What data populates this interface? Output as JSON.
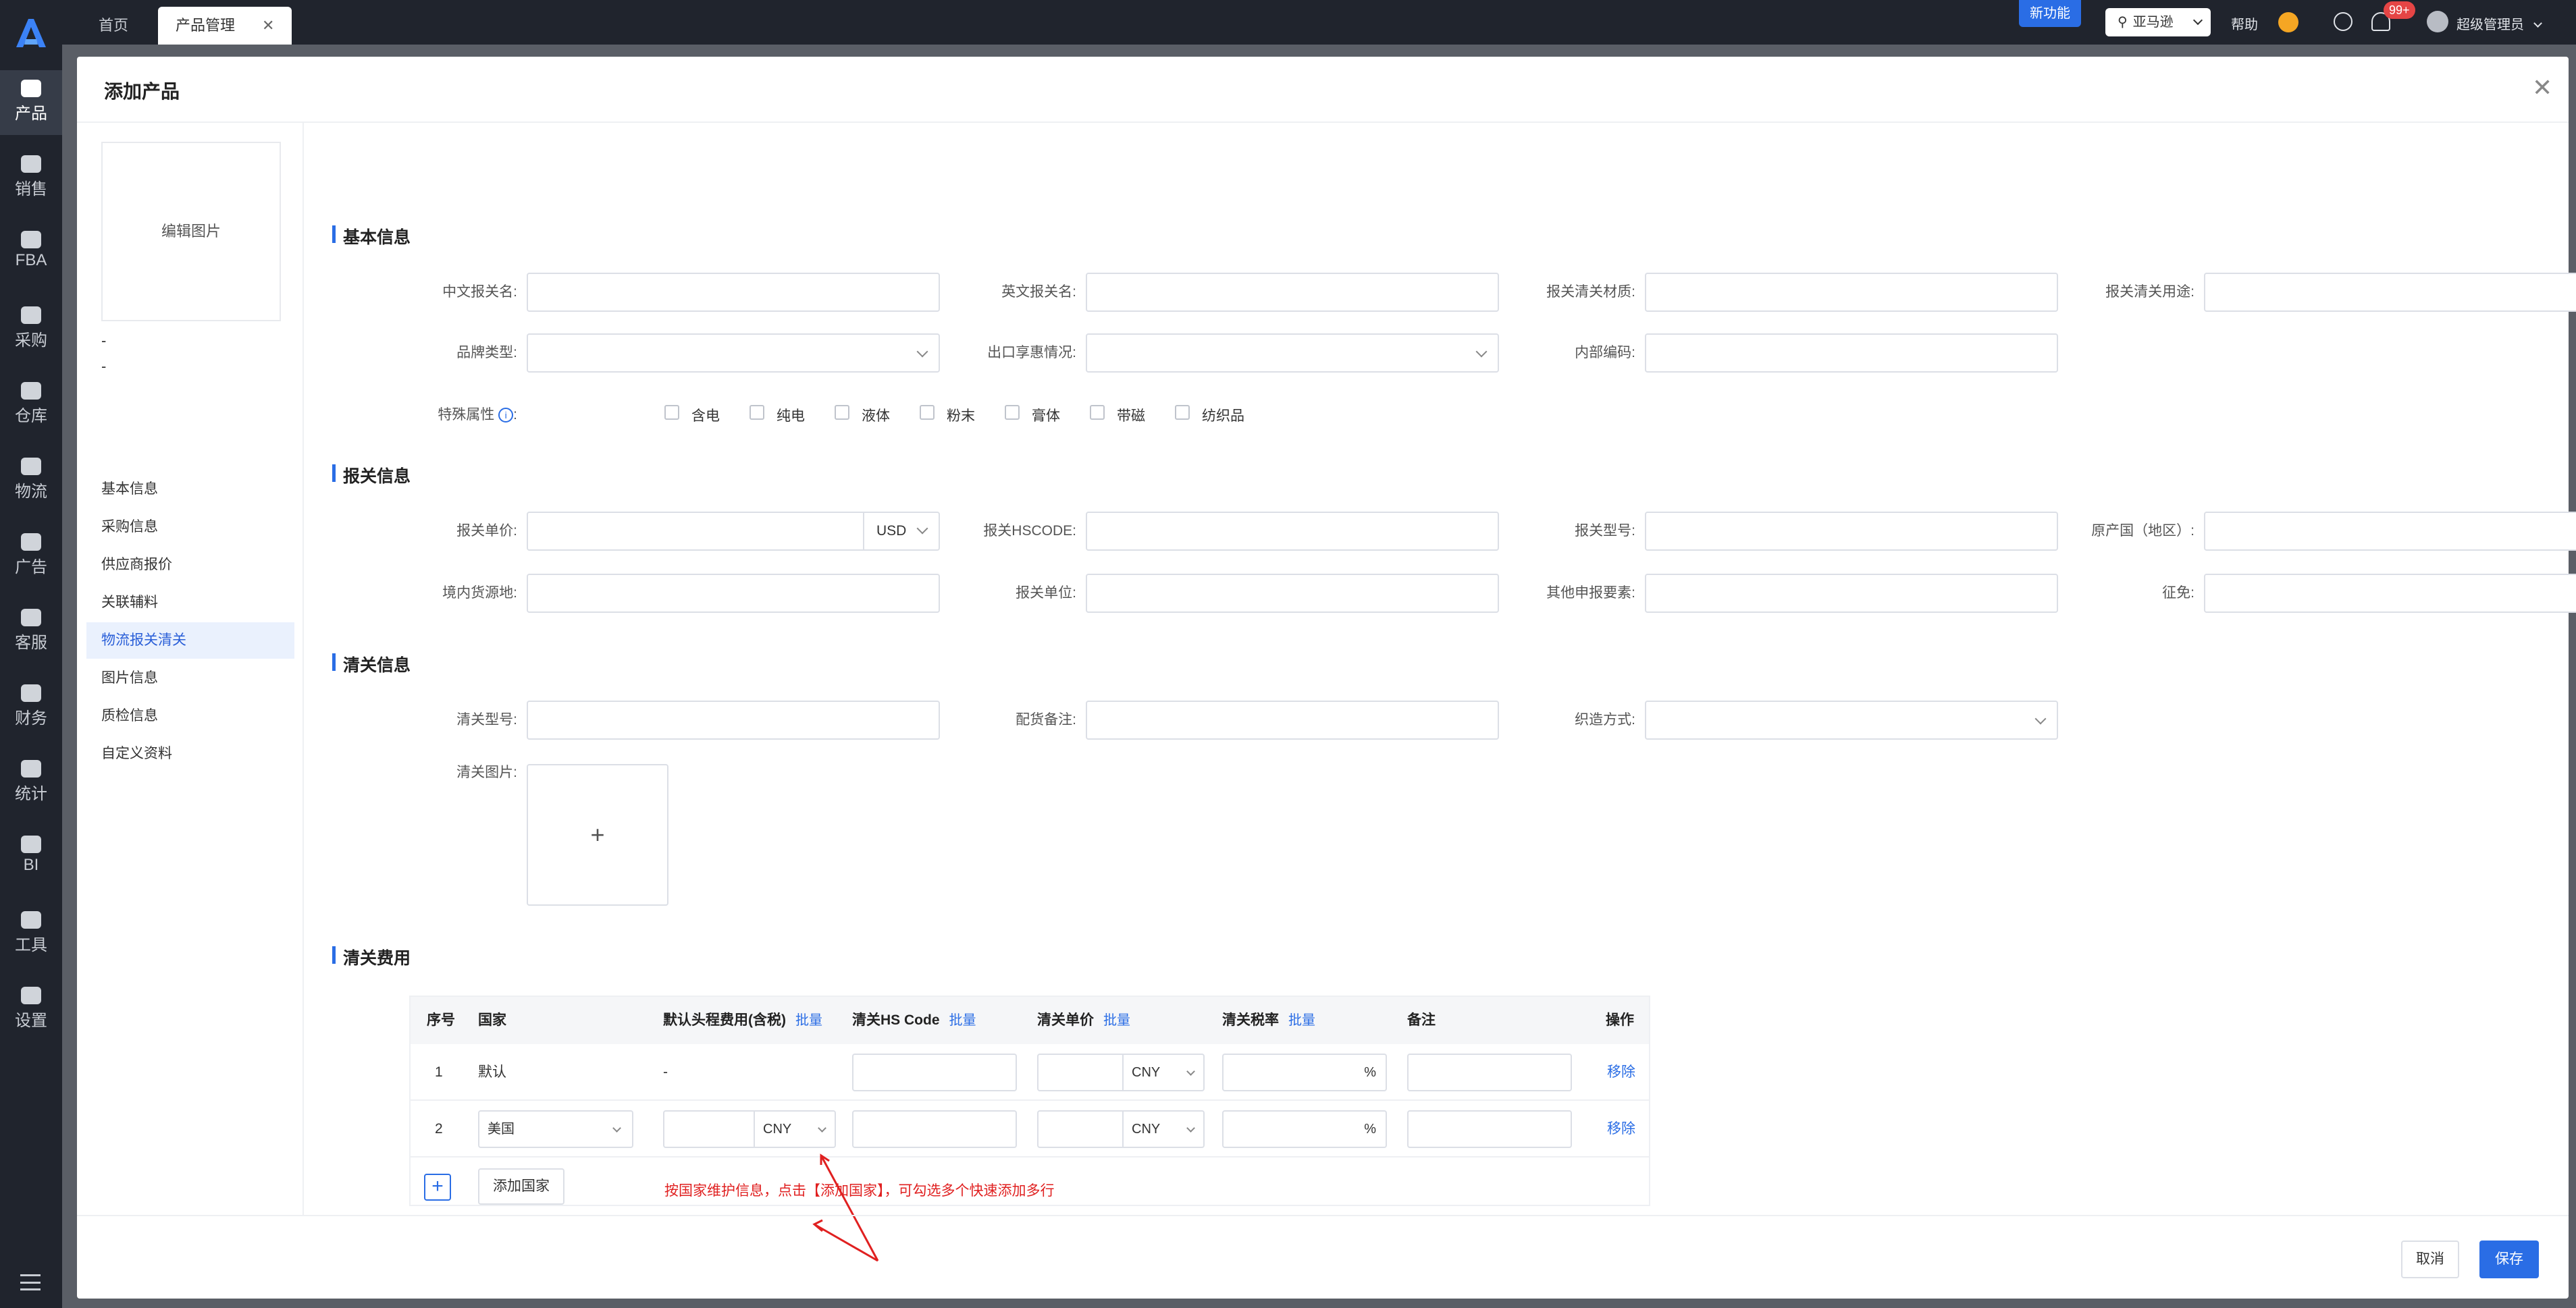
{
  "nav": {
    "items": [
      "产品",
      "销售",
      "FBA",
      "采购",
      "仓库",
      "物流",
      "广告",
      "客服",
      "财务",
      "统计",
      "BI",
      "工具",
      "设置"
    ]
  },
  "topbar": {
    "tabs": [
      "首页",
      "产品管理"
    ],
    "new_feature": "新功能",
    "platform": "亚马逊",
    "help": "帮助",
    "notify_count": "99+",
    "user": "超级管理员"
  },
  "modal": {
    "title": "添加产品",
    "edit_image": "编辑图片",
    "dash1": "-",
    "dash2": "-",
    "side_items": [
      "基本信息",
      "采购信息",
      "供应商报价",
      "关联辅料",
      "物流报关清关",
      "图片信息",
      "质检信息",
      "自定义资料"
    ]
  },
  "basic": {
    "title": "基本信息",
    "cn_name": "中文报关名:",
    "en_name": "英文报关名:",
    "material": "报关清关材质:",
    "usage": "报关清关用途:",
    "brand_type": "品牌类型:",
    "export_benefit": "出口享惠情况:",
    "internal_code": "内部编码:",
    "special_attr": "特殊属性",
    "special_colon": ":",
    "attrs": [
      "含电",
      "纯电",
      "液体",
      "粉末",
      "膏体",
      "带磁",
      "纺织品"
    ]
  },
  "customs": {
    "title": "报关信息",
    "unit_price": "报关单价:",
    "currency": "USD",
    "hscode": "报关HSCODE:",
    "model": "报关型号:",
    "origin": "原产国（地区）:",
    "source": "境内货源地:",
    "unit": "报关单位:",
    "other": "其他申报要素:",
    "exempt": "征免:"
  },
  "clearance": {
    "title": "清关信息",
    "model": "清关型号:",
    "remark": "配货备注:",
    "weaving": "织造方式:",
    "image": "清关图片:",
    "upload": "+"
  },
  "fees": {
    "title": "清关费用",
    "columns": {
      "no": "序号",
      "country": "国家",
      "head_fee": "默认头程费用(含税)",
      "hs_code": "清关HS Code",
      "unit_price": "清关单价",
      "tax_rate": "清关税率",
      "note": "备注",
      "action": "操作",
      "batch": "批量"
    },
    "rows": [
      {
        "no": "1",
        "country": "默认",
        "head_fee": "-",
        "currency": "CNY",
        "percent": "%",
        "action": "移除"
      },
      {
        "no": "2",
        "country": "美国",
        "head_fee_currency": "CNY",
        "currency": "CNY",
        "percent": "%",
        "action": "移除"
      }
    ],
    "add_plus": "+",
    "add_country": "添加国家",
    "annotation": "按国家维护信息，点击【添加国家】，可勾选多个快速添加多行"
  },
  "footer": {
    "cancel": "取消",
    "save": "保存"
  },
  "colors": {
    "accent": "#2a6de5",
    "sidebar": "#20242d",
    "annotation": "#e02020"
  }
}
